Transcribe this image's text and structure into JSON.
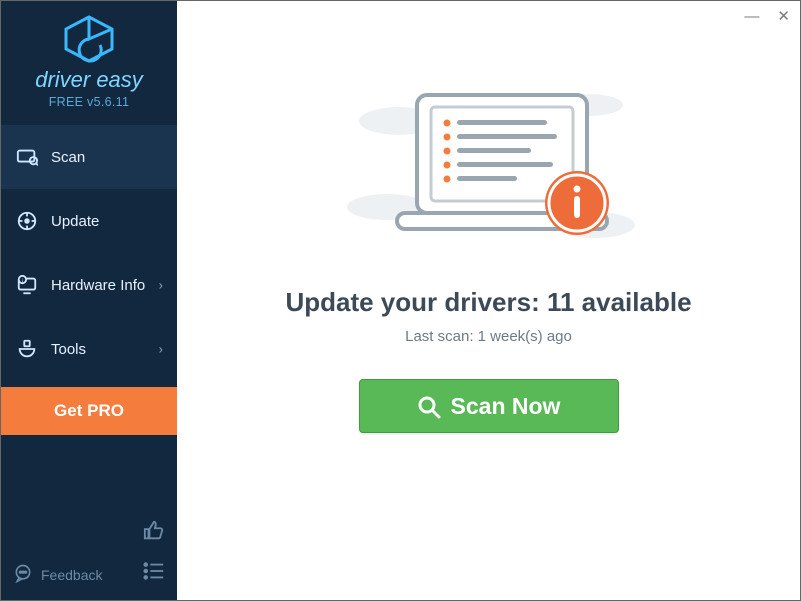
{
  "brand": {
    "wordmark": "driver easy",
    "version": "FREE v5.6.11"
  },
  "sidebar": {
    "items": [
      {
        "label": "Scan",
        "expandable": false
      },
      {
        "label": "Update",
        "expandable": false
      },
      {
        "label": "Hardware Info",
        "expandable": true
      },
      {
        "label": "Tools",
        "expandable": true
      }
    ],
    "get_pro": "Get PRO",
    "feedback": "Feedback"
  },
  "main": {
    "headline": "Update your drivers: 11 available",
    "subline": "Last scan: 1 week(s) ago",
    "scan_button": "Scan Now"
  },
  "colors": {
    "accent_orange": "#f47c3c",
    "accent_green": "#58b956",
    "sidebar_bg": "#12283f"
  }
}
